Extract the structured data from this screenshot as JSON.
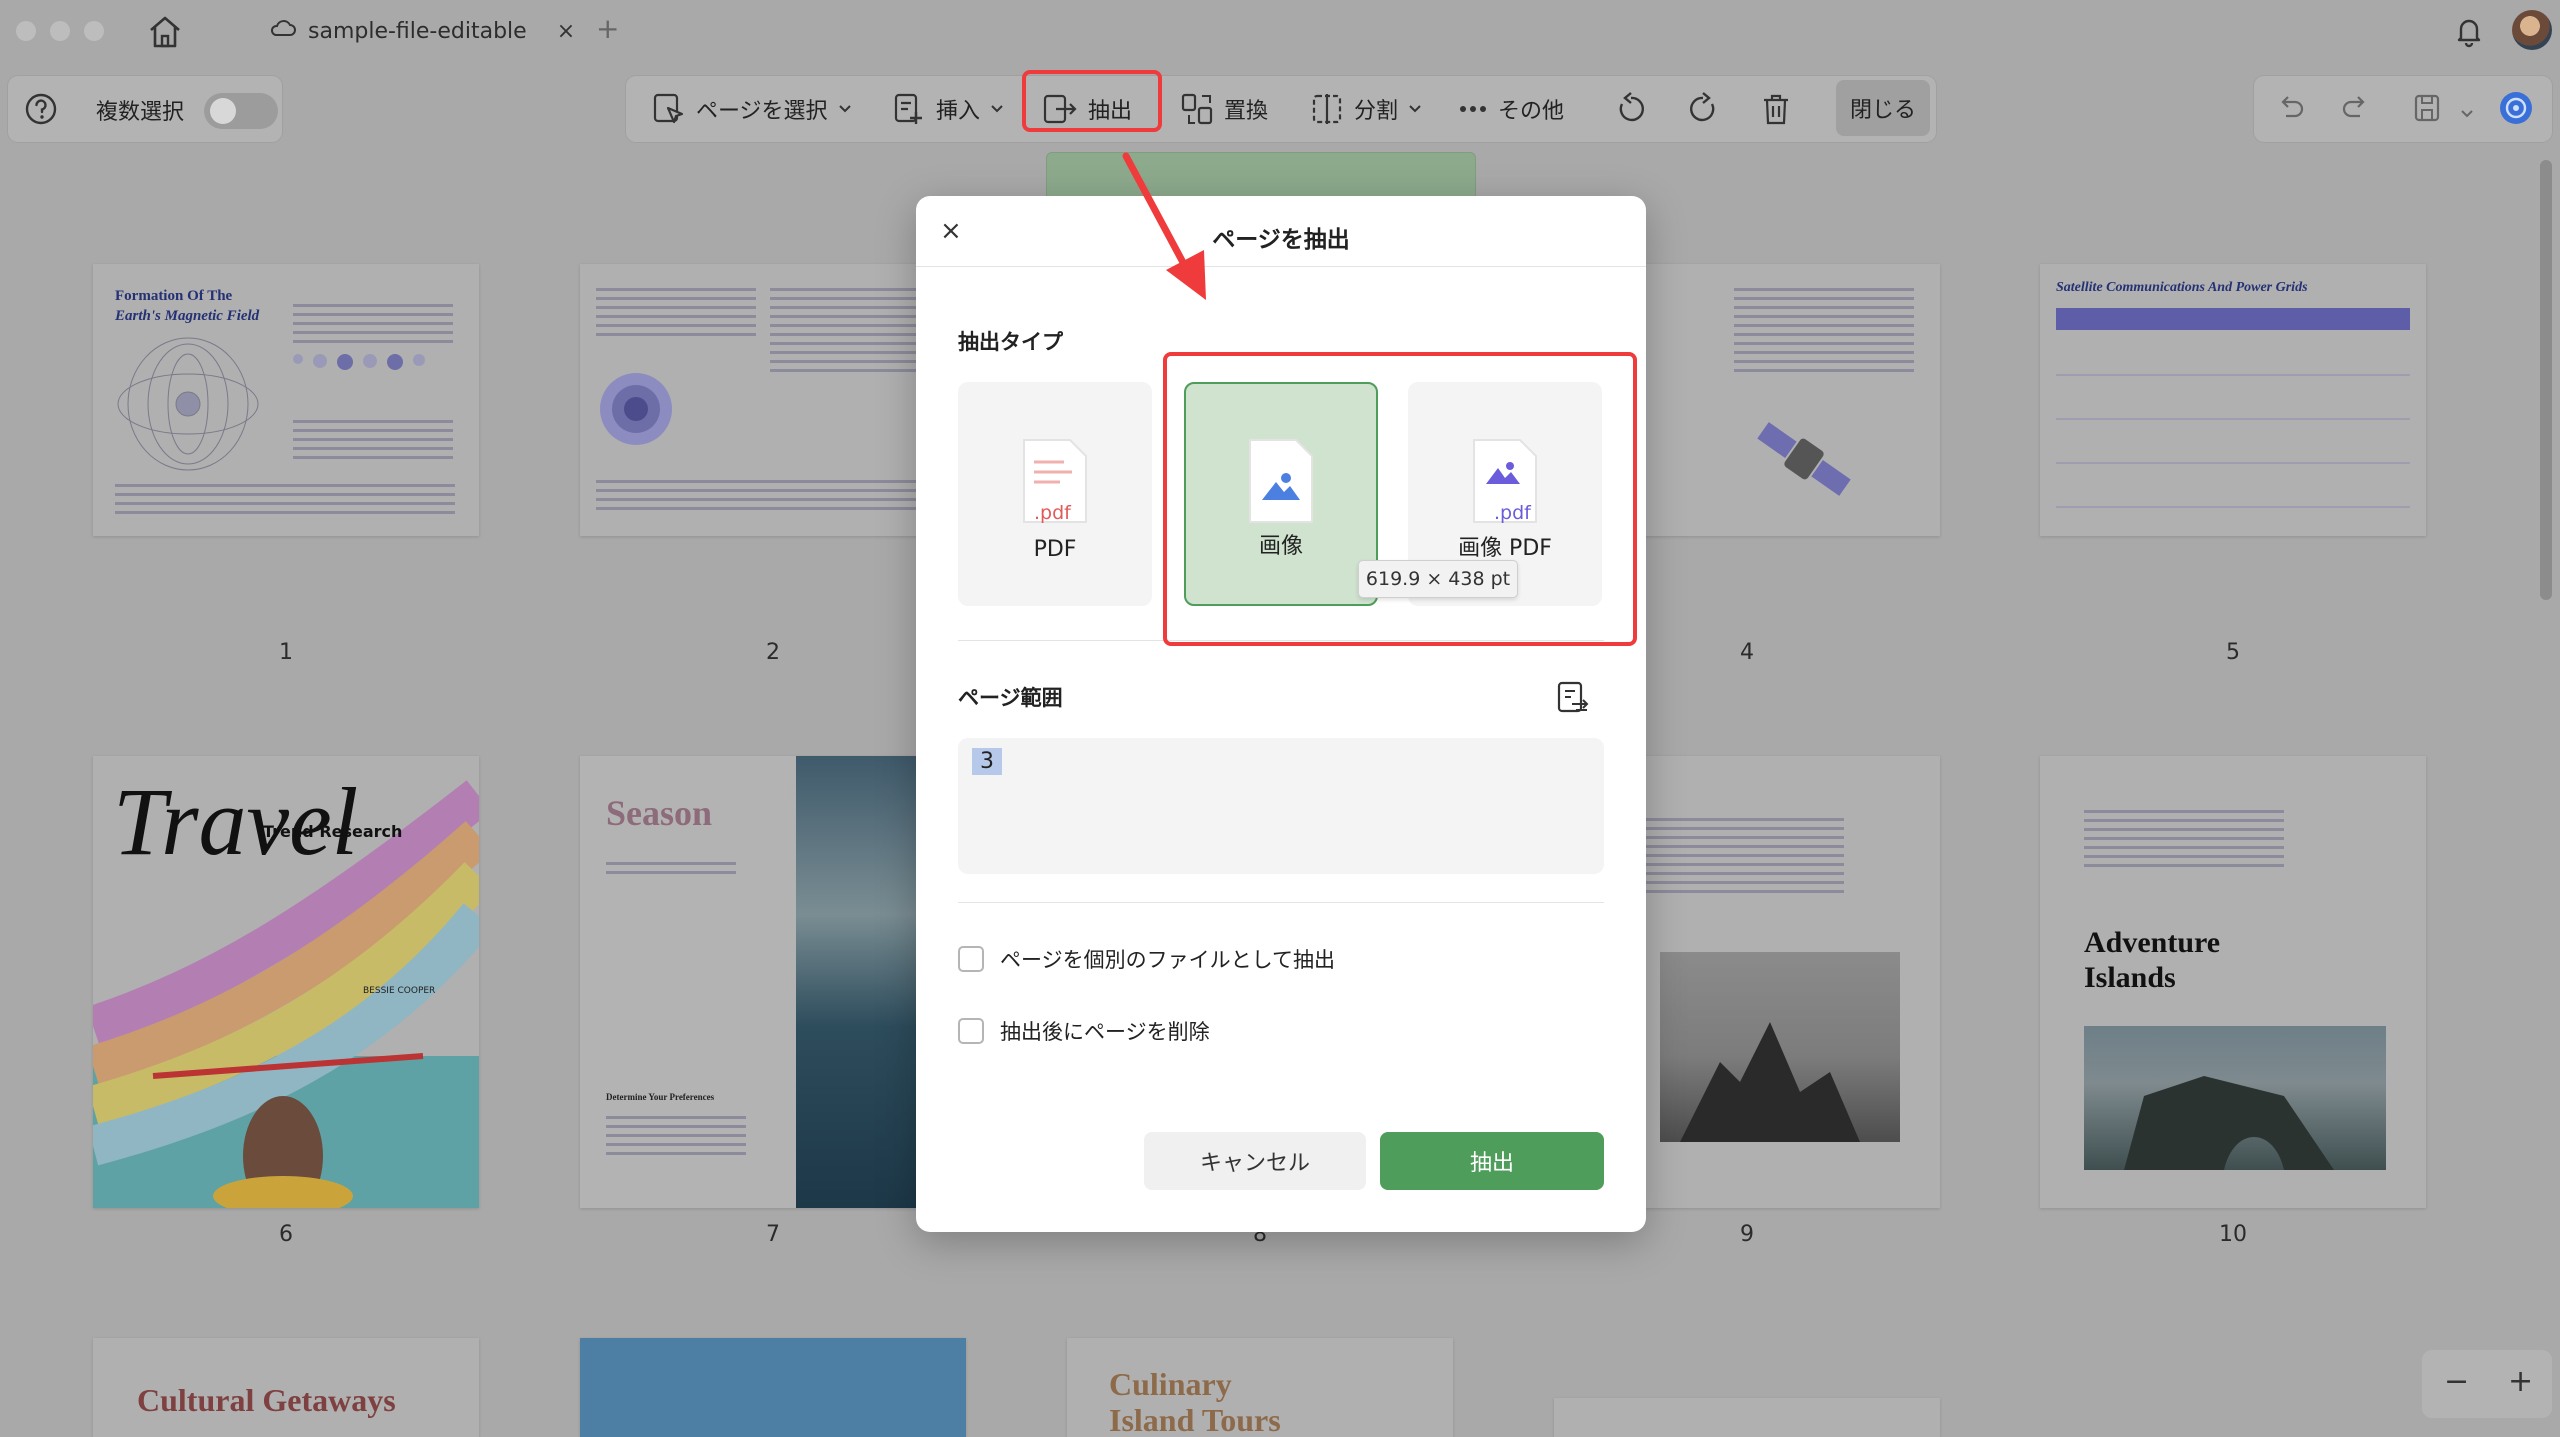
{
  "titlebar": {
    "tab_title": "sample-file-editable",
    "tab_close": "×",
    "new_tab": "+"
  },
  "toolbar_left": {
    "multi_select_label": "複数選択"
  },
  "toolbar": {
    "select_page": "ページを選択",
    "insert": "挿入",
    "extract": "抽出",
    "replace": "置換",
    "split": "分割",
    "more": "その他",
    "close": "閉じる"
  },
  "pages": [
    {
      "number": "1",
      "title": "Formation Of The",
      "title2": "Earth's Magnetic Field"
    },
    {
      "number": "2"
    },
    {
      "number": "4"
    },
    {
      "number": "5",
      "title": "Satellite Communications And Power Grids"
    },
    {
      "number": "6",
      "title": "Travel",
      "subtitle": "Trend Research",
      "author": "BESSIE COOPER"
    },
    {
      "number": "7",
      "title": "Season",
      "subtitle": "Determine Your Preferences"
    },
    {
      "number": "8"
    },
    {
      "number": "9"
    },
    {
      "number": "10",
      "title": "Adventure",
      "title2": "Islands"
    },
    {
      "title": "Cultural Getaways"
    },
    {
      "title": "Culinary",
      "title2": "Island Tours"
    }
  ],
  "dialog": {
    "close": "×",
    "title": "ページを抽出",
    "type_label": "抽出タイプ",
    "types": [
      {
        "label": "PDF",
        "badge": ".pdf"
      },
      {
        "label": "画像"
      },
      {
        "label": "画像 PDF",
        "badge": ".pdf"
      }
    ],
    "selected_type": "画像",
    "tooltip": "619.9 × 438 pt",
    "range_label": "ページ範囲",
    "range_value": "3",
    "options": [
      {
        "label": "ページを個別のファイルとして抽出",
        "checked": false
      },
      {
        "label": "抽出後にページを削除",
        "checked": false
      }
    ],
    "cancel": "キャンセル",
    "extract": "抽出"
  },
  "zoom": {
    "minus": "−",
    "plus": "+"
  },
  "colors": {
    "accent_green": "#4f9d5b",
    "highlight_red": "#ef3b3b",
    "pdf_red": "#e25a58",
    "image_blue": "#4b7fe0",
    "imagepdf_purple": "#6a5cdb"
  }
}
